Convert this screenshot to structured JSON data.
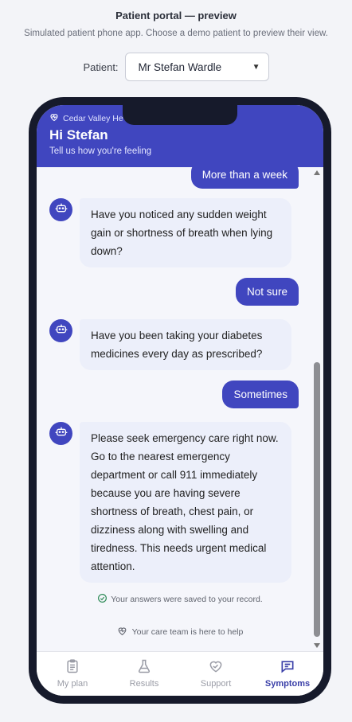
{
  "header": {
    "title": "Patient portal — preview",
    "subtitle": "Simulated patient phone app. Choose a demo patient to preview their view.",
    "patient_label": "Patient:",
    "patient_selected": "Mr Stefan Wardle"
  },
  "app": {
    "brand": "Cedar Valley He",
    "greeting": "Hi Stefan",
    "greeting_sub": "Tell us how you're feeling",
    "accent": "#4046bf"
  },
  "chat": {
    "messages": [
      {
        "from": "user",
        "text": "More than a week"
      },
      {
        "from": "bot",
        "text": "Have you noticed any sudden weight gain or shortness of breath when lying down?"
      },
      {
        "from": "user",
        "text": "Not sure"
      },
      {
        "from": "bot",
        "text": "Have you been taking your diabetes medicines every day as prescribed?"
      },
      {
        "from": "user",
        "text": "Sometimes"
      },
      {
        "from": "bot",
        "text": "Please seek emergency care right now. Go to the nearest emergency department or call 911 immediately because you are having severe shortness of breath, chest pain, or dizziness along with swelling and tiredness. This needs urgent medical attention."
      }
    ],
    "saved_notice": "Your answers were saved to your record.",
    "care_notice": "Your care team is here to help"
  },
  "tabs": [
    {
      "label": "My plan",
      "icon": "clipboard-icon"
    },
    {
      "label": "Results",
      "icon": "flask-icon"
    },
    {
      "label": "Support",
      "icon": "heart-hand-icon"
    },
    {
      "label": "Symptoms",
      "icon": "chat-icon"
    }
  ],
  "active_tab": "Symptoms"
}
